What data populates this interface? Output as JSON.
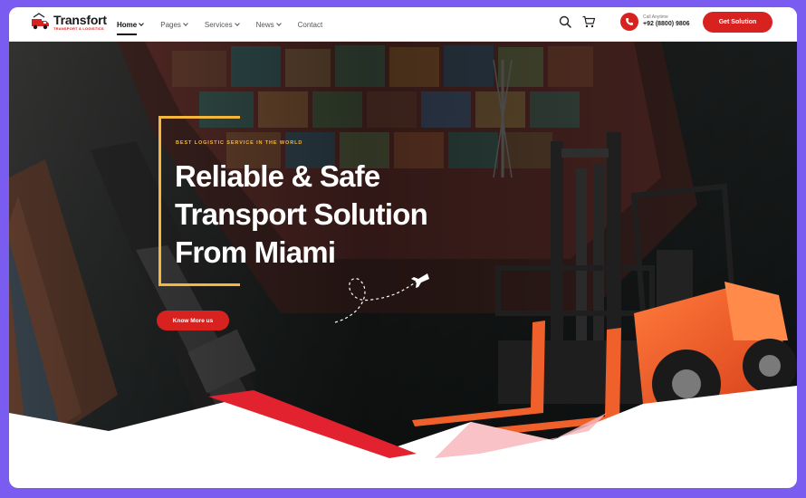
{
  "brand": {
    "name": "Transfort",
    "tagline": "TRANSPORT & LOGISTICS"
  },
  "nav": {
    "items": [
      {
        "label": "Home",
        "has_dropdown": true,
        "active": true
      },
      {
        "label": "Pages",
        "has_dropdown": true,
        "active": false
      },
      {
        "label": "Services",
        "has_dropdown": true,
        "active": false
      },
      {
        "label": "News",
        "has_dropdown": true,
        "active": false
      },
      {
        "label": "Contact",
        "has_dropdown": false,
        "active": false
      }
    ]
  },
  "header": {
    "search_icon": "search-icon",
    "cart_icon": "cart-icon",
    "call_label": "Call Anytime",
    "call_number": "+92 (8800) 9806",
    "cta_label": "Get Solution"
  },
  "hero": {
    "eyebrow": "BEST LOGISTIC SERVICE IN THE WORLD",
    "title_lines": [
      "Reliable & Safe",
      "Transport Solution",
      "From Miami"
    ],
    "button_label": "Know More us"
  },
  "colors": {
    "accent": "#d7221f",
    "highlight": "#f4b73b",
    "frame": "#7b5cf0",
    "forklift": "#f0602a"
  }
}
